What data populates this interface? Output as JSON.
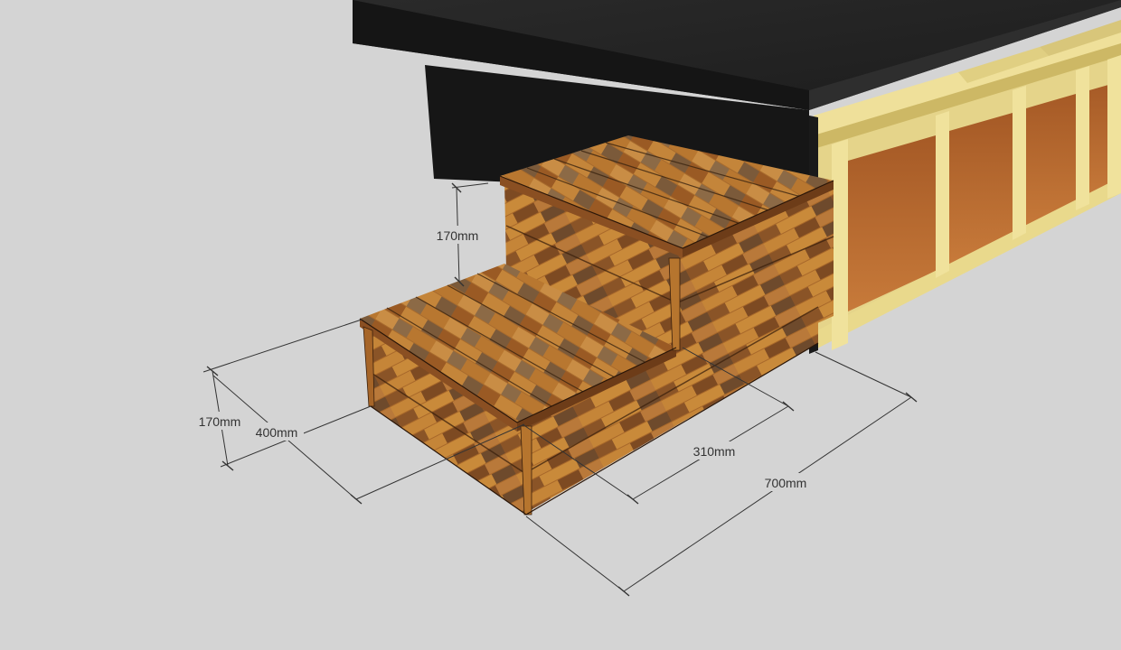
{
  "dimensions": {
    "riser_upper": "170mm",
    "riser_lower": "170mm",
    "lower_tread_depth": "400mm",
    "upper_tread_depth": "310mm",
    "total_width": "700mm"
  },
  "colors": {
    "background": "#d4d4d4",
    "deck_surface": "#1f1f1f",
    "wood_light": "#b7792f",
    "wood_dark": "#7a4320",
    "frame_pine": "#e8d891",
    "panel_ply": "#b8672e",
    "dimension_line": "#333333"
  }
}
